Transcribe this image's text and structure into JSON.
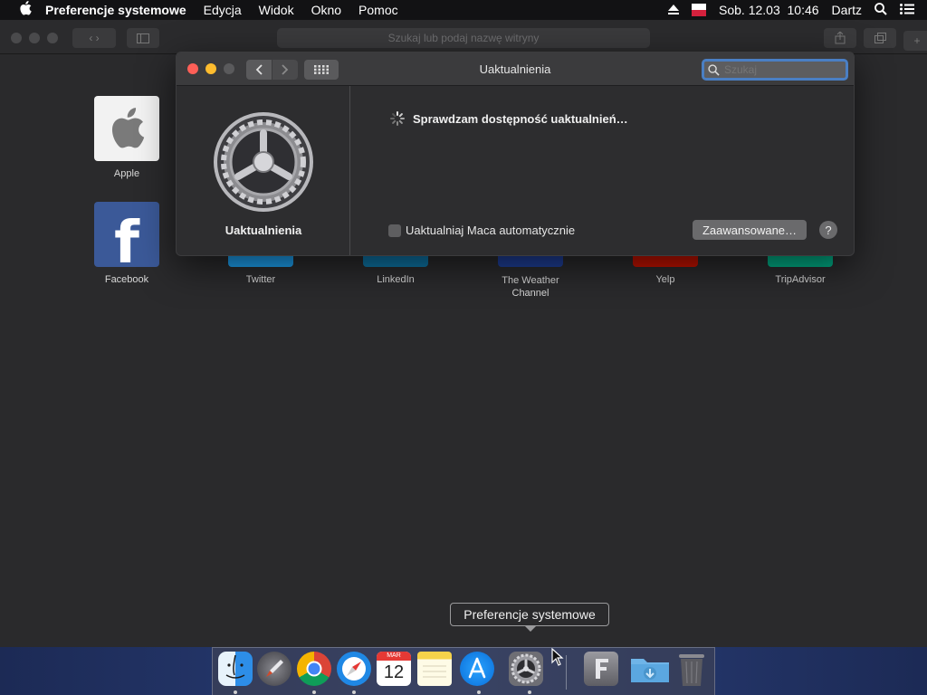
{
  "menubar": {
    "apple_icon": "apple-logo-icon",
    "app_name": "Preferencje systemowe",
    "items": [
      "Edycja",
      "Widok",
      "Okno",
      "Pomoc"
    ],
    "datetime": "Sob. 12.03  10:46",
    "user": "Dartz",
    "right_icons": [
      "eject-icon",
      "flag-icon",
      "search-icon",
      "list-icon"
    ]
  },
  "safari": {
    "url_placeholder": "Szukaj lub podaj nazwę witryny"
  },
  "favorites": [
    {
      "label": "Apple",
      "color": "#f2f2f2"
    },
    {
      "label": "Facebook",
      "color": "#3b5998"
    },
    {
      "label": "Twitter",
      "color": "#1da1f2"
    },
    {
      "label": "LinkedIn",
      "color": "#0e76a8"
    },
    {
      "label": "The Weather Channel",
      "color": "#1f3f99"
    },
    {
      "label": "Yelp",
      "color": "#c41200"
    },
    {
      "label": "TripAdvisor",
      "color": "#00af87"
    }
  ],
  "prefs_window": {
    "title": "Uaktualnienia",
    "search_placeholder": "Szukaj",
    "pane_label": "Uaktualnienia",
    "status": "Sprawdzam dostępność uaktualnień…",
    "auto_update_label": "Uaktualniaj Maca automatycznie",
    "auto_update_checked": false,
    "advanced_button": "Zaawansowane…",
    "help_button": "?"
  },
  "tooltip": "Preferencje systemowe",
  "dock": {
    "items": [
      {
        "name": "finder-icon",
        "running": true
      },
      {
        "name": "launchpad-icon",
        "running": false
      },
      {
        "name": "chrome-icon",
        "running": true
      },
      {
        "name": "safari-icon",
        "running": true
      },
      {
        "name": "calendar-icon",
        "running": false
      },
      {
        "name": "notes-icon",
        "running": false
      },
      {
        "name": "app-store-icon",
        "running": true
      },
      {
        "name": "system-preferences-icon",
        "running": true
      },
      {
        "name": "font-book-icon",
        "running": false
      },
      {
        "name": "downloads-folder-icon",
        "running": false
      },
      {
        "name": "trash-icon",
        "running": false
      }
    ],
    "calendar_month": "MAR",
    "calendar_day": "12"
  }
}
